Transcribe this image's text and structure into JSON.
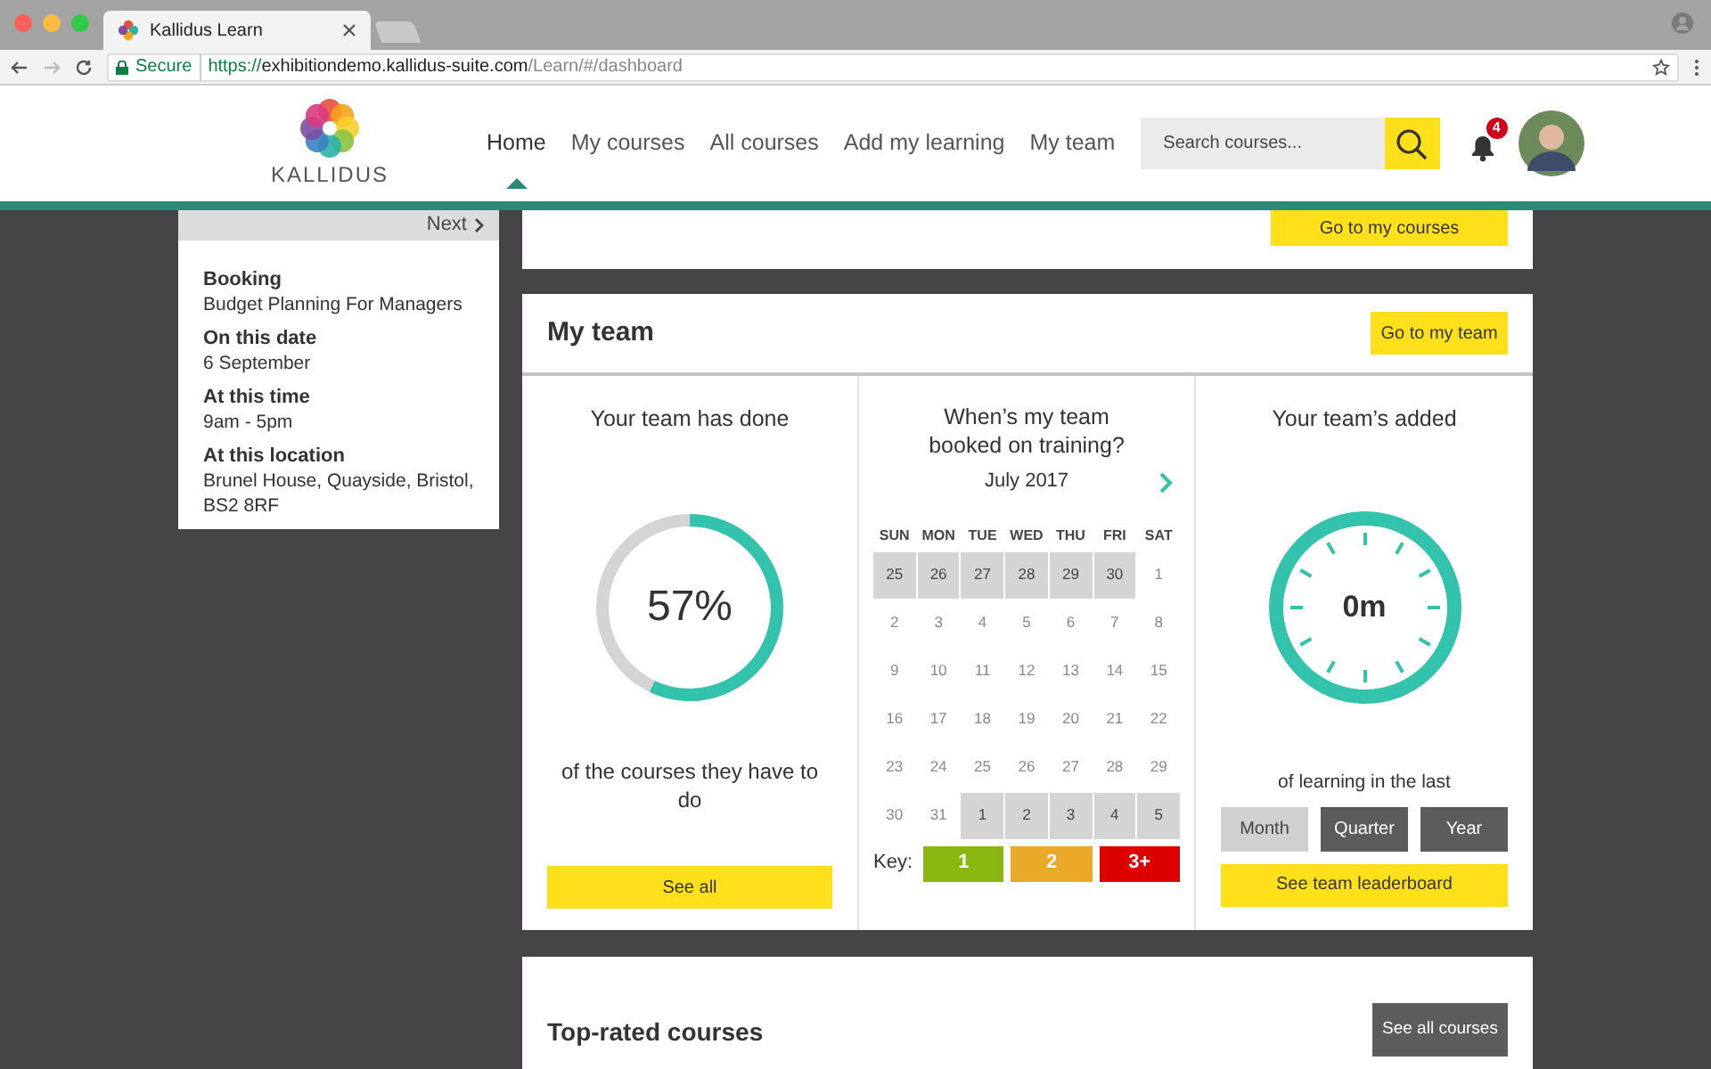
{
  "browser": {
    "tab_title": "Kallidus Learn",
    "secure_label": "Secure",
    "url_scheme": "https://",
    "url_host": "exhibitiondemo.kallidus-suite.com",
    "url_path": "/Learn/#/dashboard"
  },
  "header": {
    "logo_text": "KALLIDUS",
    "nav": [
      {
        "label": "Home",
        "selected": true
      },
      {
        "label": "My courses",
        "selected": false
      },
      {
        "label": "All courses",
        "selected": false
      },
      {
        "label": "Add my learning",
        "selected": false
      },
      {
        "label": "My team",
        "selected": false
      }
    ],
    "search": {
      "placeholder": "Search courses..."
    },
    "notification_count": "4"
  },
  "booking_popup": {
    "next_label": "Next",
    "fields": [
      {
        "label": "Booking",
        "value": "Budget Planning For Managers"
      },
      {
        "label": "On this date",
        "value": "6 September"
      },
      {
        "label": "At this time",
        "value": "9am - 5pm"
      },
      {
        "label": "At this location",
        "value": "Brunel House, Quayside, Bristol, BS2 8RF"
      }
    ]
  },
  "top_card": {
    "button": "Go to my courses"
  },
  "my_team": {
    "title": "My team",
    "button": "Go to my team",
    "done": {
      "title": "Your team has done",
      "level": 0.57,
      "value": "57%",
      "caption": "of the courses they have to do",
      "button": "See all"
    },
    "calendar": {
      "title": "When’s my team booked on training?",
      "month": "July 2017",
      "weekdays": [
        "SUN",
        "MON",
        "TUE",
        "WED",
        "THU",
        "FRI",
        "SAT"
      ],
      "weeks": [
        [
          {
            "day": "25",
            "shaded": true
          },
          {
            "day": "26",
            "shaded": true
          },
          {
            "day": "27",
            "shaded": true
          },
          {
            "day": "28",
            "shaded": true
          },
          {
            "day": "29",
            "shaded": true
          },
          {
            "day": "30",
            "shaded": true
          },
          {
            "day": "1",
            "shaded": false
          }
        ],
        [
          {
            "day": "2",
            "shaded": false
          },
          {
            "day": "3",
            "shaded": false
          },
          {
            "day": "4",
            "shaded": false
          },
          {
            "day": "5",
            "shaded": false
          },
          {
            "day": "6",
            "shaded": false
          },
          {
            "day": "7",
            "shaded": false
          },
          {
            "day": "8",
            "shaded": false
          }
        ],
        [
          {
            "day": "9",
            "shaded": false
          },
          {
            "day": "10",
            "shaded": false
          },
          {
            "day": "11",
            "shaded": false
          },
          {
            "day": "12",
            "shaded": false
          },
          {
            "day": "13",
            "shaded": false
          },
          {
            "day": "14",
            "shaded": false
          },
          {
            "day": "15",
            "shaded": false
          }
        ],
        [
          {
            "day": "16",
            "shaded": false
          },
          {
            "day": "17",
            "shaded": false
          },
          {
            "day": "18",
            "shaded": false
          },
          {
            "day": "19",
            "shaded": false
          },
          {
            "day": "20",
            "shaded": false
          },
          {
            "day": "21",
            "shaded": false
          },
          {
            "day": "22",
            "shaded": false
          }
        ],
        [
          {
            "day": "23",
            "shaded": false
          },
          {
            "day": "24",
            "shaded": false
          },
          {
            "day": "25",
            "shaded": false
          },
          {
            "day": "26",
            "shaded": false
          },
          {
            "day": "27",
            "shaded": false
          },
          {
            "day": "28",
            "shaded": false
          },
          {
            "day": "29",
            "shaded": false
          }
        ],
        [
          {
            "day": "30",
            "shaded": false
          },
          {
            "day": "31",
            "shaded": false
          },
          {
            "day": "1",
            "shaded": true
          },
          {
            "day": "2",
            "shaded": true
          },
          {
            "day": "3",
            "shaded": true
          },
          {
            "day": "4",
            "shaded": true
          },
          {
            "day": "5",
            "shaded": true
          }
        ]
      ],
      "key_label": "Key:",
      "key": [
        {
          "label": "1",
          "color": "#8ab712"
        },
        {
          "label": "2",
          "color": "#eaa928"
        },
        {
          "label": "3+",
          "color": "#dd0000"
        }
      ]
    },
    "added": {
      "title": "Your team’s added",
      "value": "0m",
      "caption": "of learning in the last",
      "periods": [
        {
          "label": "Month",
          "selected": true
        },
        {
          "label": "Quarter",
          "selected": false
        },
        {
          "label": "Year",
          "selected": false
        }
      ],
      "button": "See team leaderboard"
    }
  },
  "top_rated": {
    "title": "Top-rated courses",
    "button": "See all courses"
  }
}
